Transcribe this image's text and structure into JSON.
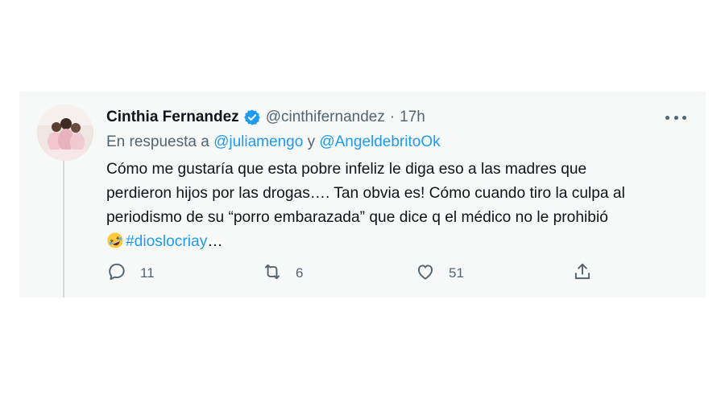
{
  "tweet": {
    "author_name": "Cinthia Fernandez",
    "handle": "@cinthifernandez",
    "separator": "·",
    "time": "17h",
    "reply_prefix": "En respuesta a",
    "mention_1": "@juliamengo",
    "reply_and": "y",
    "mention_2": "@AngeldebritoOk",
    "text_lines": [
      "Cómo me gustaría que esta pobre infeliz le diga eso a las madres que",
      "perdieron hijos por las drogas…. Tan obvia es!  Cómo cuando tiro la culpa al",
      "periodismo de su “porro embarazada” que dice q el médico no le prohibió"
    ],
    "emoji": "rolling-on-floor-laughing",
    "hashtag": "#dioslocriay",
    "ellipsis": "…",
    "replies": "11",
    "retweets": "6",
    "likes": "51"
  },
  "colors": {
    "accent": "#1d9bf0",
    "text": "#0f1419",
    "secondary": "#536471",
    "card_bg": "#f7f9f9"
  },
  "icons": [
    "verified-badge-icon",
    "more-icon",
    "reply-icon",
    "retweet-icon",
    "like-icon",
    "share-icon"
  ]
}
